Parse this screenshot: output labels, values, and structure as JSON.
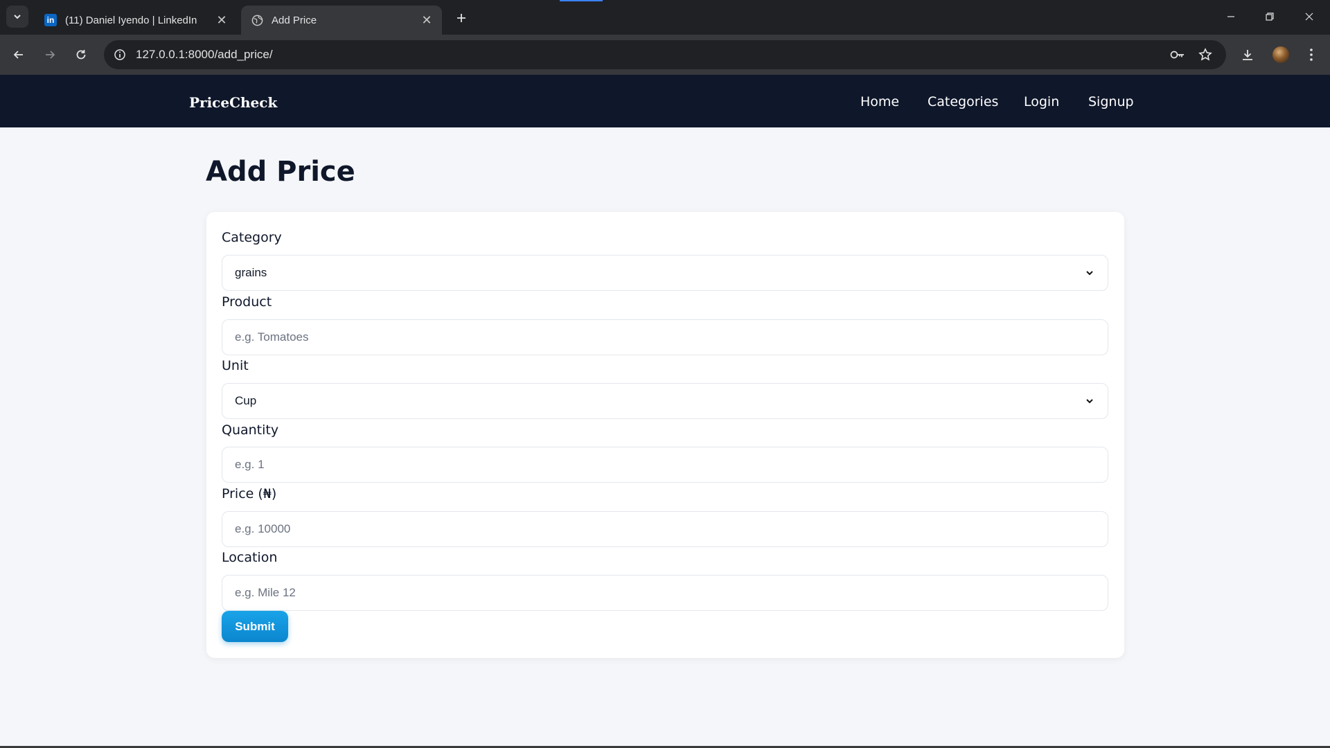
{
  "browser": {
    "tabs": [
      {
        "title": "(11) Daniel Iyendo | LinkedIn",
        "favicon": "linkedin-icon",
        "favicon_text": "in",
        "active": false
      },
      {
        "title": "Add Price",
        "favicon": "globe-icon",
        "active": true
      }
    ],
    "url": "127.0.0.1:8000/add_price/"
  },
  "site": {
    "brand": "PriceCheck",
    "nav": [
      "Home",
      "Categories",
      "Login",
      "Signup"
    ]
  },
  "page": {
    "title": "Add Price",
    "form": {
      "category": {
        "label": "Category",
        "value": "grains"
      },
      "product": {
        "label": "Product",
        "placeholder": "e.g. Tomatoes"
      },
      "unit": {
        "label": "Unit",
        "value": "Cup"
      },
      "quantity": {
        "label": "Quantity",
        "placeholder": "e.g. 1"
      },
      "price": {
        "label": "Price (₦)",
        "placeholder": "e.g. 10000"
      },
      "location": {
        "label": "Location",
        "placeholder": "e.g. Mile 12"
      },
      "submit_label": "Submit"
    }
  },
  "colors": {
    "nav_bg": "#0f172a",
    "page_bg": "#f4f6f9",
    "accent": "#0b86cf"
  }
}
